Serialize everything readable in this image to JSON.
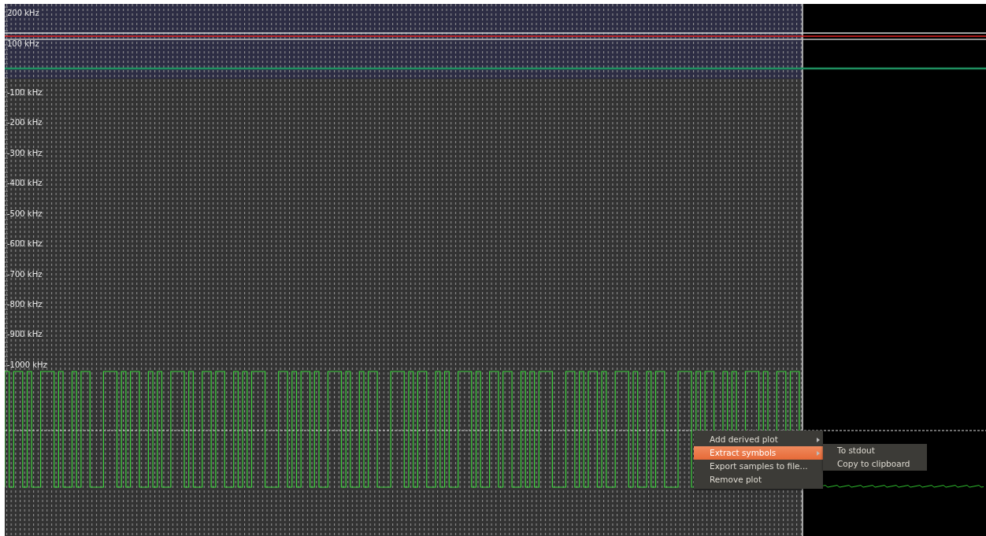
{
  "frequency_axis": {
    "labels": [
      {
        "text": "200 kHz"
      },
      {
        "text": "100 kHz"
      },
      {
        "text": "-100 kHz"
      },
      {
        "text": "-200 kHz"
      },
      {
        "text": "-300 kHz"
      },
      {
        "text": "-400 kHz"
      },
      {
        "text": "-500 kHz"
      },
      {
        "text": "-600 kHz"
      },
      {
        "text": "-700 kHz"
      },
      {
        "text": "-800 kHz"
      },
      {
        "text": "-900 kHz"
      },
      {
        "text": "-1000 kHz"
      }
    ]
  },
  "context_menu": {
    "items": [
      {
        "label": "Add derived plot",
        "selected": false,
        "has_submenu": true
      },
      {
        "label": "Extract symbols",
        "selected": true,
        "has_submenu": true
      },
      {
        "label": "Export samples to file...",
        "selected": false,
        "has_submenu": false
      },
      {
        "label": "Remove plot",
        "selected": false,
        "has_submenu": false
      }
    ]
  },
  "submenu": {
    "items": [
      {
        "label": "To stdout"
      },
      {
        "label": "Copy to clipboard"
      }
    ]
  }
}
